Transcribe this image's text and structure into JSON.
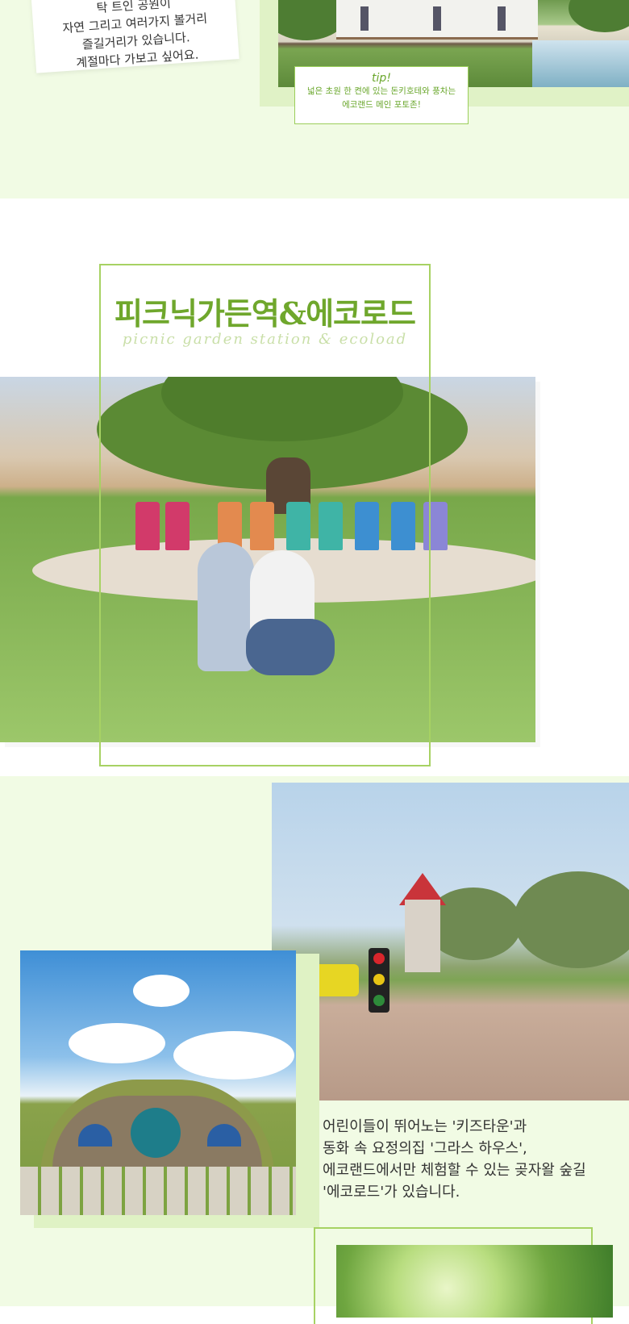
{
  "top_section": {
    "note_lines": [
      "탁 트인 공원이",
      "자연 그리고 여러가지 볼거리",
      "즐길거리가 있습니다.",
      "계절마다 가보고 싶어요."
    ],
    "tip": {
      "title": "tip!",
      "lines": [
        "넓은 초원 한 켠에 있는 돈키호테와 풍차는",
        "에코랜드 메인 포토존!"
      ]
    }
  },
  "picnic_section": {
    "title": "피크닉가든역&에코로드",
    "subtitle": "picnic garden station & ecoload"
  },
  "bottom_section": {
    "description_lines": [
      "어린이들이 뛰어노는 '키즈타운'과",
      "동화 속 요정의집 '그라스 하우스',",
      "에코랜드에서만 체험할 수 있는 곶자왈 숲길",
      "'에코로드'가 있습니다."
    ]
  },
  "colors": {
    "accent_green": "#6fa72c",
    "frame_green": "#a7d263",
    "band_background": "#f1fbe4"
  }
}
